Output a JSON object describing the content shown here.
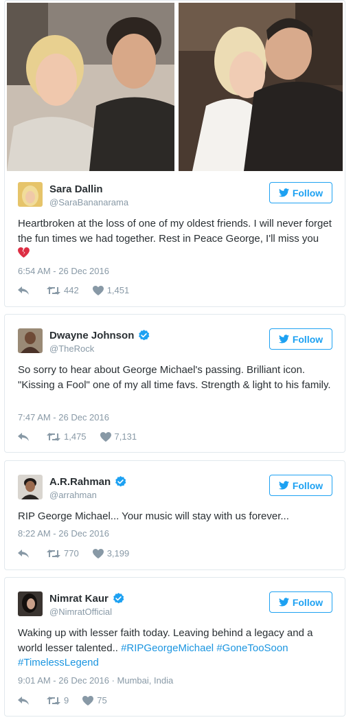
{
  "follow_label": "Follow",
  "colors": {
    "accent": "#1da1f2",
    "muted": "#8899a6",
    "text": "#292f33",
    "link": "#1b95e0"
  },
  "tweets": [
    {
      "name": "Sara Dallin",
      "handle": "@SaraBananarama",
      "verified": false,
      "text": "Heartbroken at the loss of one of my oldest friends. I will never forget the fun times we had together. Rest in Peace George, I'll miss you",
      "emoji": "broken-heart",
      "timestamp": "6:54 AM - 26 Dec 2016",
      "retweets": "442",
      "likes": "1,451"
    },
    {
      "name": "Dwayne Johnson",
      "handle": "@TheRock",
      "verified": true,
      "text": "So sorry to hear about George Michael's passing. Brilliant icon. \"Kissing a Fool\" one of my all time favs. Strength & light to his family.",
      "timestamp": "7:47 AM - 26 Dec 2016",
      "retweets": "1,475",
      "likes": "7,131"
    },
    {
      "name": "A.R.Rahman",
      "handle": "@arrahman",
      "verified": true,
      "text": "RIP George Michael... Your music will stay with us forever...",
      "timestamp": "8:22 AM - 26 Dec 2016",
      "retweets": "770",
      "likes": "3,199"
    },
    {
      "name": "Nimrat Kaur",
      "handle": "@NimratOfficial",
      "verified": true,
      "text": "Waking up with lesser faith today. Leaving behind a legacy and a world lesser talented..",
      "hashtags": [
        "#RIPGeorgeMichael",
        "#GoneTooSoon",
        "#TimelessLegend"
      ],
      "timestamp": "9:01 AM - 26 Dec 2016",
      "location": "Mumbai, India",
      "retweets": "9",
      "likes": "75"
    }
  ]
}
